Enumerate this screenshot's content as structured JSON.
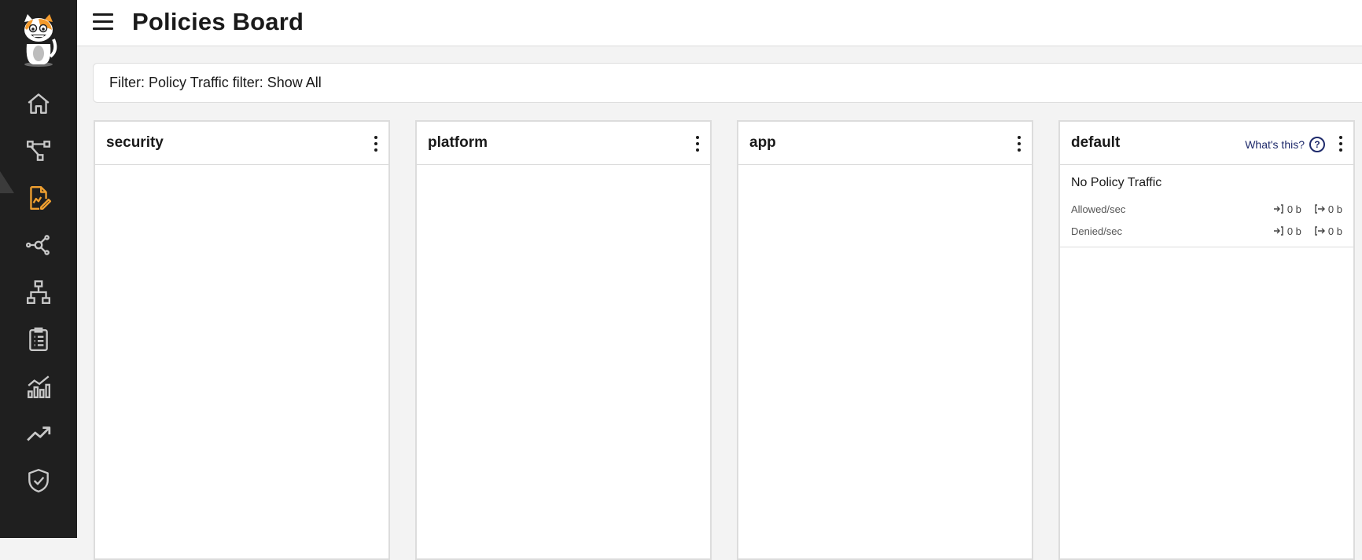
{
  "header": {
    "title": "Policies Board"
  },
  "filter": {
    "text": "Filter: Policy Traffic filter: Show All"
  },
  "sidebar": {
    "items": [
      {
        "icon": "home-icon"
      },
      {
        "icon": "flow-diagram-icon"
      },
      {
        "icon": "policy-document-icon",
        "active": true
      },
      {
        "icon": "graph-nodes-icon"
      },
      {
        "icon": "network-hierarchy-icon"
      },
      {
        "icon": "clipboard-list-icon"
      },
      {
        "icon": "bar-chart-trend-icon"
      },
      {
        "icon": "trending-up-icon"
      },
      {
        "icon": "shield-check-icon"
      }
    ],
    "active_color": "#f0a030",
    "icon_color": "#c8c8c8"
  },
  "columns": [
    {
      "title": "security"
    },
    {
      "title": "platform"
    },
    {
      "title": "app"
    },
    {
      "title": "default",
      "help_label": "What's this?",
      "help_symbol": "?",
      "traffic": {
        "title": "No Policy Traffic",
        "rows": [
          {
            "label": "Allowed/sec",
            "ingress": "0 b",
            "egress": "0 b"
          },
          {
            "label": "Denied/sec",
            "ingress": "0 b",
            "egress": "0 b"
          }
        ]
      }
    }
  ]
}
